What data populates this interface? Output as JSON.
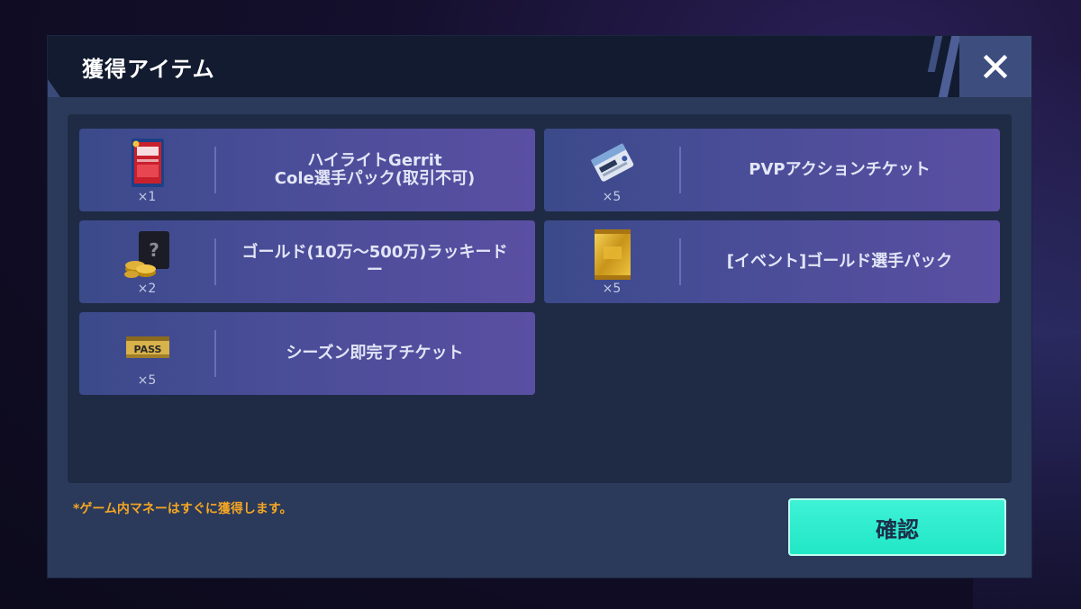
{
  "dialog": {
    "title": "獲得アイテム",
    "close_label": "X"
  },
  "items": [
    {
      "name_line1": "ハイライトGerrit",
      "name_line2": "Cole選手パック(取引不可)",
      "qty": "×1",
      "icon": "player-pack-card-icon"
    },
    {
      "name_line1": "PVPアクションチケット",
      "name_line2": "",
      "qty": "×5",
      "icon": "pvp-ticket-icon"
    },
    {
      "name_line1": "ゴールド(10万〜500万)ラッキード",
      "name_line2": "ー",
      "qty": "×2",
      "icon": "gold-coin-lucky-bag-icon"
    },
    {
      "name_line1": "[イベント]ゴールド選手パック",
      "name_line2": "",
      "qty": "×5",
      "icon": "gold-player-pack-icon"
    },
    {
      "name_line1": "シーズン即完了チケット",
      "name_line2": "",
      "qty": "×5",
      "icon": "season-pass-ticket-icon"
    }
  ],
  "note": "*ゲーム内マネーはすぐに獲得します。",
  "confirm_label": "確認"
}
